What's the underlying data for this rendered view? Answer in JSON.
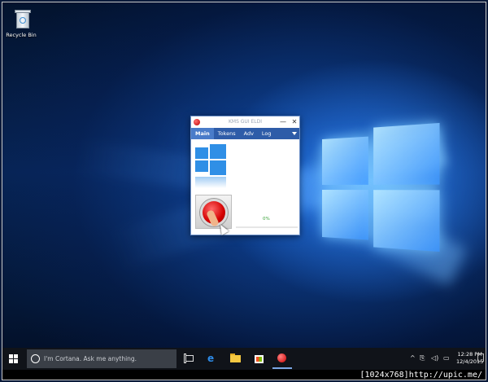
{
  "desktop": {
    "recycle_bin_label": "Recycle Bin"
  },
  "app_window": {
    "title": "KMS GUI ELDI",
    "minimize_symbol": "—",
    "close_symbol": "✕",
    "tabs": [
      {
        "label": "Main",
        "active": true
      },
      {
        "label": "Tokens",
        "active": false
      },
      {
        "label": "Adv",
        "active": false
      },
      {
        "label": "Log",
        "active": false
      }
    ],
    "progress_text": "0%",
    "progress_value": 0
  },
  "taskbar": {
    "search_placeholder": "I'm Cortana. Ask me anything.",
    "edge_glyph": "e",
    "tray_chevron": "^",
    "tray_network": "⎘",
    "tray_volume": "◁)",
    "tray_message": "▭",
    "clock_time": "12:28 PM",
    "clock_date": "12/4/2015"
  },
  "footer": {
    "caption": "[1024x768]http://upic.me/"
  },
  "colors": {
    "accent_tab_bar": "#2e5ca8",
    "active_tab": "#4a7cc9",
    "progress_text": "#3aa33a",
    "taskbar": "#101319"
  },
  "icons": [
    "recycle-bin-icon",
    "app-icon",
    "windows-logo-icon",
    "red-button-icon",
    "start-icon",
    "cortana-icon",
    "task-view-icon",
    "edge-icon",
    "file-explorer-icon",
    "store-icon",
    "kms-app-icon",
    "chevron-up-icon",
    "network-icon",
    "volume-icon",
    "message-icon",
    "notification-icon"
  ]
}
